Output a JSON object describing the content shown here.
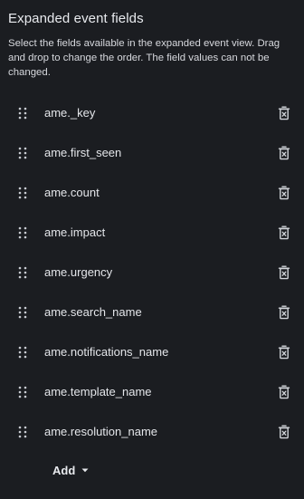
{
  "panel": {
    "title": "Expanded event fields",
    "description": "Select the fields available in the expanded event view. Drag and drop to change the order. The field values can not be changed."
  },
  "fields": [
    {
      "label": "ame._key"
    },
    {
      "label": "ame.first_seen"
    },
    {
      "label": "ame.count"
    },
    {
      "label": "ame.impact"
    },
    {
      "label": "ame.urgency"
    },
    {
      "label": "ame.search_name"
    },
    {
      "label": "ame.notifications_name"
    },
    {
      "label": "ame.template_name"
    },
    {
      "label": "ame.resolution_name"
    }
  ],
  "add_button": {
    "label": "Add"
  },
  "icons": {
    "row_handle": "drag-handle-icon",
    "row_delete": "trash-icon",
    "add_dropdown": "chevron-down-icon"
  },
  "colors": {
    "background": "#1b1d21",
    "text": "#e4e6ea",
    "icon": "#c9ccd2"
  }
}
